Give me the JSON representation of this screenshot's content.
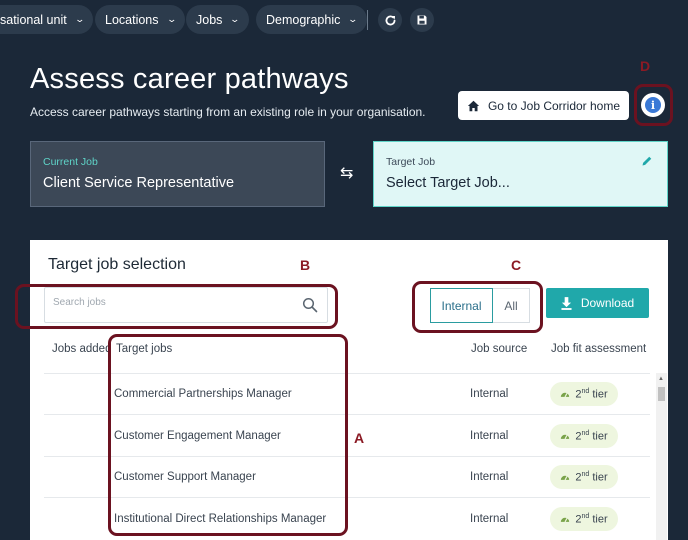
{
  "filters": [
    {
      "label": "sational unit"
    },
    {
      "label": "Locations"
    },
    {
      "label": "Jobs"
    },
    {
      "label": "Demographic"
    }
  ],
  "header": {
    "title": "Assess career pathways",
    "subtitle": "Access career pathways starting from an existing role in your organisation.",
    "corridor_button": "Go to Job Corridor home"
  },
  "current_job": {
    "label": "Current Job",
    "value": "Client Service Representative"
  },
  "target_job": {
    "label": "Target Job",
    "value": "Select Target Job..."
  },
  "panel": {
    "title": "Target job selection",
    "search_placeholder": "Search jobs",
    "toggle": {
      "internal": "Internal",
      "all": "All",
      "selected": "Internal"
    },
    "download_label": "Download",
    "columns": {
      "jobs_added": "Jobs added",
      "target_jobs": "Target jobs",
      "job_source": "Job source",
      "job_fit": "Job fit assessment"
    },
    "rows": [
      {
        "job": "Commercial Partnerships Manager",
        "source": "Internal",
        "tier_num": "2",
        "tier_sup": "nd",
        "tier_word": "tier"
      },
      {
        "job": "Customer Engagement Manager",
        "source": "Internal",
        "tier_num": "2",
        "tier_sup": "nd",
        "tier_word": "tier"
      },
      {
        "job": "Customer Support Manager",
        "source": "Internal",
        "tier_num": "2",
        "tier_sup": "nd",
        "tier_word": "tier"
      },
      {
        "job": "Institutional Direct Relationships Manager",
        "source": "Internal",
        "tier_num": "2",
        "tier_sup": "nd",
        "tier_word": "tier"
      }
    ]
  },
  "annotations": {
    "a": "A",
    "b": "B",
    "c": "C",
    "d": "D"
  },
  "colors": {
    "background": "#1b2838",
    "accent_teal": "#20a8aa",
    "annotation": "#6b1220",
    "tier_badge": "#eef6df"
  },
  "icons": [
    "refresh-icon",
    "save-icon",
    "home-icon",
    "info-icon",
    "swap-icon",
    "pencil-icon",
    "search-icon",
    "download-icon",
    "gauge-icon"
  ]
}
